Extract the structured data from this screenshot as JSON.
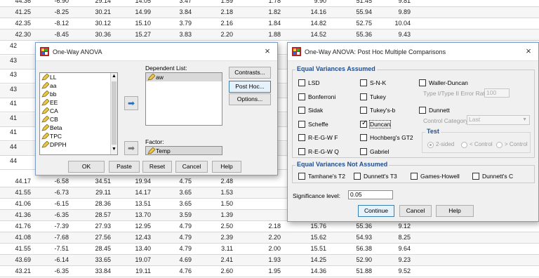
{
  "sheet": {
    "rows_top": [
      [
        "44.36",
        "-6.90",
        "29.14",
        "14.05",
        "3.47",
        "1.59",
        "1.78",
        "9.90",
        "51.45",
        "9.81"
      ],
      [
        "41.25",
        "-8.25",
        "30.21",
        "14.99",
        "3.84",
        "2.18",
        "1.82",
        "14.16",
        "55.94",
        "9.89"
      ],
      [
        "42.35",
        "-8.12",
        "30.12",
        "15.10",
        "3.79",
        "2.16",
        "1.84",
        "14.82",
        "52.75",
        "10.04"
      ],
      [
        "42.30",
        "-8.45",
        "30.36",
        "15.27",
        "3.83",
        "2.20",
        "1.88",
        "14.52",
        "55.36",
        "9.43"
      ]
    ],
    "rows_bottom": [
      [
        "44.17",
        "-6.58",
        "34.51",
        "19.94",
        "4.75",
        "2.48",
        "",
        "",
        "",
        ""
      ],
      [
        "41.55",
        "-6.73",
        "29.11",
        "14.17",
        "3.65",
        "1.53",
        "",
        "",
        "",
        ""
      ],
      [
        "41.06",
        "-6.15",
        "28.36",
        "13.51",
        "3.65",
        "1.50",
        "",
        "",
        "",
        ""
      ],
      [
        "41.36",
        "-6.35",
        "28.57",
        "13.70",
        "3.59",
        "1.39",
        "",
        "",
        "",
        ""
      ],
      [
        "41.76",
        "-7.39",
        "27.93",
        "12.95",
        "4.79",
        "2.50",
        "2.18",
        "15.76",
        "55.36",
        "9.12"
      ],
      [
        "41.08",
        "-7.68",
        "27.56",
        "12.43",
        "4.79",
        "2.39",
        "2.20",
        "15.62",
        "54.93",
        "8.25"
      ],
      [
        "41.55",
        "-7.51",
        "28.45",
        "13.40",
        "4.79",
        "3.11",
        "2.00",
        "15.51",
        "56.38",
        "9.64"
      ],
      [
        "43.69",
        "-6.14",
        "33.65",
        "19.07",
        "4.69",
        "2.41",
        "1.93",
        "14.25",
        "52.90",
        "9.23"
      ],
      [
        "43.21",
        "-6.35",
        "33.84",
        "19.11",
        "4.76",
        "2.60",
        "1.95",
        "14.36",
        "51.88",
        "9.52"
      ]
    ],
    "left_col_partial": [
      "42",
      "43",
      "43",
      "43",
      "41",
      "41",
      "41",
      "44",
      "44"
    ]
  },
  "anova": {
    "title": "One-Way ANOVA",
    "close": "×",
    "variables": [
      "LL",
      "aa",
      "bb",
      "EE",
      "CA",
      "CB",
      "Beta",
      "TPC",
      "DPPH"
    ],
    "dependent_label": "Dependent List:",
    "dependent_items": [
      "aw"
    ],
    "factor_label": "Factor:",
    "factor_value": "Temp",
    "side_buttons": [
      "Contrasts...",
      "Post Hoc...",
      "Options..."
    ],
    "bottom_buttons": [
      "OK",
      "Paste",
      "Reset",
      "Cancel",
      "Help"
    ]
  },
  "posthoc": {
    "title": "One-Way ANOVA: Post Hoc Multiple Comparisons",
    "close": "×",
    "equal_assumed_label": "Equal Variances Assumed",
    "col1": [
      {
        "label": "LSD",
        "checked": false
      },
      {
        "label": "Bonferroni",
        "checked": false
      },
      {
        "label": "Sidak",
        "checked": false
      },
      {
        "label": "Scheffe",
        "checked": false
      },
      {
        "label": "R-E-G-W F",
        "checked": false
      },
      {
        "label": "R-E-G-W Q",
        "checked": false
      }
    ],
    "col2": [
      {
        "label": "S-N-K",
        "checked": false
      },
      {
        "label": "Tukey",
        "checked": false
      },
      {
        "label": "Tukey's-b",
        "checked": false
      },
      {
        "label": "Duncan",
        "checked": true
      },
      {
        "label": "Hochberg's GT2",
        "checked": false
      },
      {
        "label": "Gabriel",
        "checked": false
      }
    ],
    "waller": "Waller-Duncan",
    "type_ratio_label": "Type I/Type II Error Ratio:",
    "type_ratio_value": "100",
    "dunnett": "Dunnett",
    "control_category_label": "Control Category:",
    "control_category_value": "Last",
    "test_label": "Test",
    "test_options": [
      "2-sided",
      "< Control",
      "> Control"
    ],
    "not_assumed_label": "Equal Variances Not Assumed",
    "not_assumed": [
      "Tamhane's T2",
      "Dunnett's T3",
      "Games-Howell",
      "Dunnett's C"
    ],
    "significance_label": "Significance level:",
    "significance_value": "0.05",
    "buttons": [
      "Continue",
      "Cancel",
      "Help"
    ]
  },
  "colors": {
    "accent": "#1f4e8c",
    "grid_line": "#d8d8d8",
    "dialog_bg": "#f0f0f0"
  }
}
